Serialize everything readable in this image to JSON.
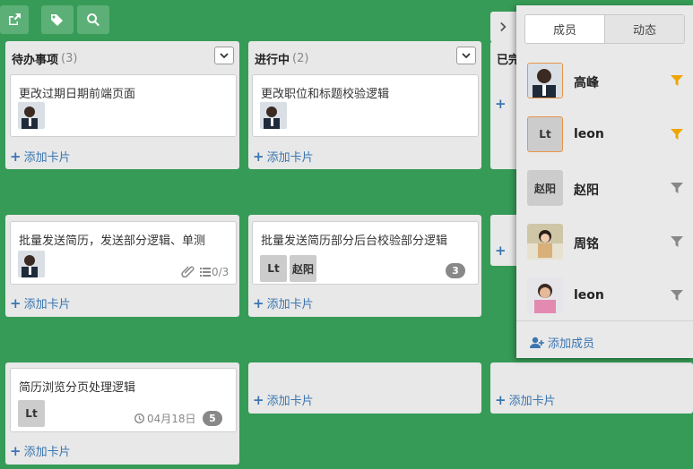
{
  "toolbar": {
    "buttons": [
      {
        "icon": "share-icon"
      },
      {
        "icon": "tag-icon"
      },
      {
        "icon": "search-icon"
      }
    ]
  },
  "lists": [
    {
      "title": "待办事项",
      "count": "(3)"
    },
    {
      "title": "进行中",
      "count": "(2)"
    },
    {
      "title": "已完"
    }
  ],
  "add_card_label": "添加卡片",
  "cards": {
    "c1": {
      "title": "更改过期日期前端页面"
    },
    "c2": {
      "title": "更改职位和标题校验逻辑"
    },
    "c3": {
      "title": "批量发送简历，发送部分逻辑、单测",
      "checklist": "0/3"
    },
    "c4": {
      "title": "批量发送简历部分后台校验部分逻辑",
      "badge": "3",
      "avatars": [
        "Lt",
        "赵阳"
      ]
    },
    "c5": {
      "title": "简历浏览分页处理逻辑",
      "due": "04月18日",
      "badge": "5",
      "avatars": [
        "Lt"
      ]
    }
  },
  "panel": {
    "tabs": [
      "成员",
      "动态"
    ],
    "members": [
      {
        "name": "高峰",
        "avatar_text": "",
        "filter_color": "#f0a500"
      },
      {
        "name": "leon",
        "avatar_text": "Lt",
        "filter_color": "#f0a500"
      },
      {
        "name": "赵阳",
        "avatar_text": "赵阳",
        "filter_color": "#888888"
      },
      {
        "name": "周铭",
        "avatar_text": "",
        "filter_color": "#888888"
      },
      {
        "name": "leon",
        "avatar_text": "",
        "filter_color": "#888888"
      }
    ],
    "add_member": "添加成员"
  },
  "colors": {
    "board_bg": "#369b56",
    "link": "#3a76b0",
    "filter_active": "#f0a500"
  }
}
